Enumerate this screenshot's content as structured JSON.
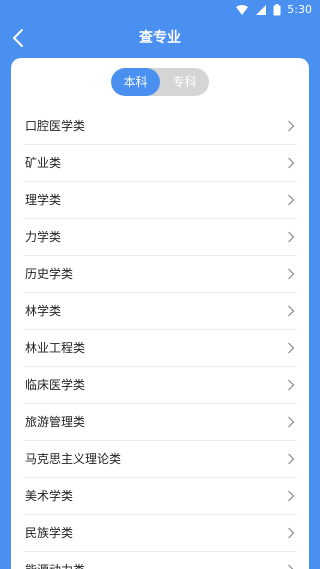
{
  "status_bar": {
    "time": "5:30",
    "icons": [
      "wifi-icon",
      "signal-icon",
      "battery-icon"
    ]
  },
  "header": {
    "title": "查专业",
    "back_icon": "back-arrow-icon"
  },
  "segmented": {
    "options": [
      {
        "label": "本科",
        "selected": true
      },
      {
        "label": "专科",
        "selected": false
      }
    ]
  },
  "majors": [
    {
      "label": "口腔医学类"
    },
    {
      "label": "矿业类"
    },
    {
      "label": "理学类"
    },
    {
      "label": "力学类"
    },
    {
      "label": "历史学类"
    },
    {
      "label": "林学类"
    },
    {
      "label": "林业工程类"
    },
    {
      "label": "临床医学类"
    },
    {
      "label": "旅游管理类"
    },
    {
      "label": "马克思主义理论类"
    },
    {
      "label": "美术学类"
    },
    {
      "label": "民族学类"
    },
    {
      "label": "能源动力类"
    }
  ],
  "colors": {
    "primary": "#4A90F0",
    "segment_inactive": "#D5D5D5",
    "card_bg": "#FFFFFF",
    "divider": "#EDEDED",
    "text": "#222222",
    "chevron": "#888888"
  }
}
